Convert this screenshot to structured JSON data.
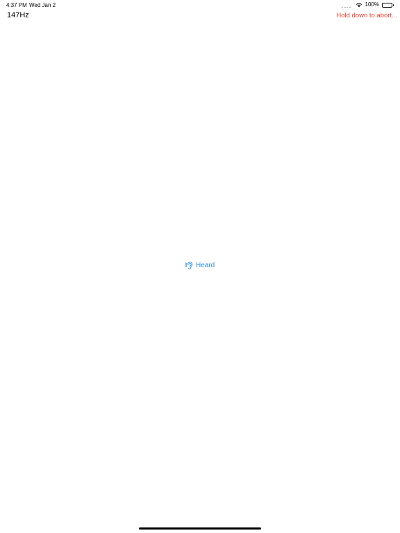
{
  "status_bar": {
    "time": "4:37 PM",
    "date": "Wed Jan 2",
    "battery_percent": "100%",
    "battery_level": 1.0,
    "icons": [
      "signal-dots-icon",
      "wifi-icon",
      "battery-icon"
    ]
  },
  "nav": {
    "frequency": "147Hz",
    "abort_hint": "Hold down to abort..."
  },
  "main": {
    "heard_label": "Heard",
    "heard_icon": "ear-icon"
  },
  "colors": {
    "accent_blue": "#2e8fe6",
    "abort_red": "#e8402f",
    "background": "#ffffff"
  }
}
